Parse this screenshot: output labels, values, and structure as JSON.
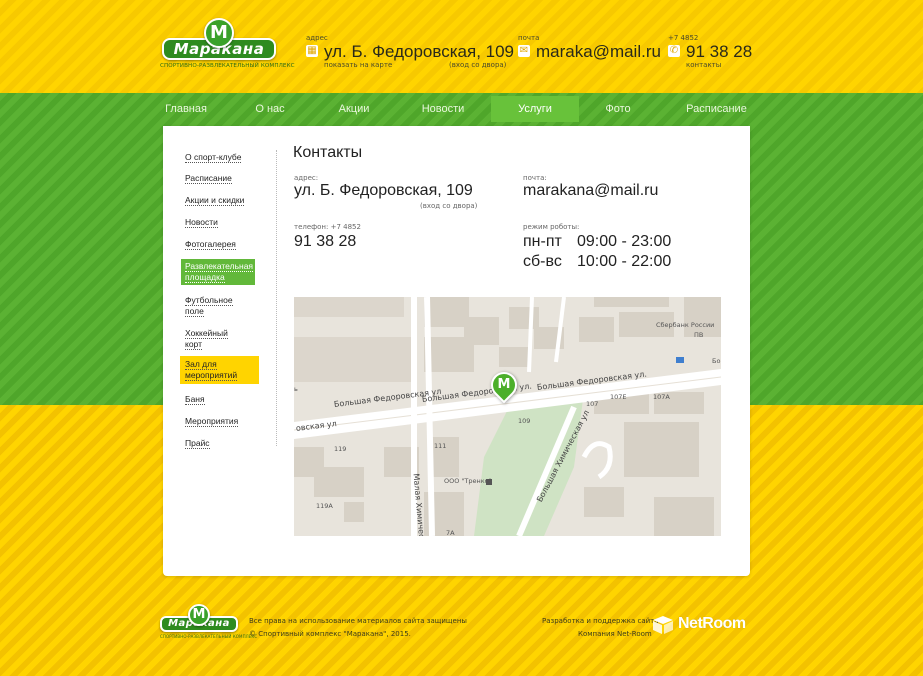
{
  "brand": {
    "logo_text": "Маракана",
    "logo_letter": "M",
    "tagline": "спортивно-развлекательный комплекс"
  },
  "header": {
    "address_label": "адрес",
    "address_value": "ул. Б. Федоровская, 109",
    "address_show_map": "показать на карте",
    "address_entrance": "(вход со двора)",
    "email_label": "почта",
    "email_value": "maraka@mail.ru",
    "phone_label": "+7 4852",
    "phone_value": "91 38 28",
    "phone_sub": "контакты"
  },
  "nav": {
    "items": [
      "Главная",
      "О нас",
      "Акции",
      "Новости",
      "Услуги",
      "Фото",
      "Расписание"
    ],
    "active_index": 4
  },
  "sidebar": {
    "items": [
      "О спорт-клубе",
      "Расписание",
      "Акции и скидки",
      "Новости",
      "Фотогалерея",
      "Развлекательная площадка",
      "Футбольное поле",
      "Хоккейный корт",
      "Зал для мероприятий",
      "Баня",
      "Мероприятия",
      "Прайс"
    ]
  },
  "contacts": {
    "title": "Контакты",
    "address_label": "адрес:",
    "address_value": "ул. Б. Федоровская, 109",
    "address_sub": "(вход со двора)",
    "email_label": "почта:",
    "email_value": "marakana@mail.ru",
    "phone_label": "телефон: +7 4852",
    "phone_value": "91 38 28",
    "hours_label": "режим роботы:",
    "hours": [
      {
        "days": "пн-пт",
        "time": "09:00 - 23:00"
      },
      {
        "days": "сб-вс",
        "time": "10:00 - 22:00"
      }
    ]
  },
  "map": {
    "pin_letter": "M",
    "streets": {
      "main_left": "овская ул",
      "main_mid": "Большая Федоровская ул",
      "main_right": "Большая Федоровская ул.",
      "main_far": "Большая Федоровская ул.",
      "malaya": "Малая Химическая",
      "bolshaya_chem": "Большая Химическая ул"
    },
    "labels": {
      "sberbank": "Сбербанк России",
      "sberbank_sub": "ПВ",
      "l107": "107",
      "l107e": "107Е",
      "l107a": "107А",
      "l109": "109",
      "l111": "111",
      "l119": "119",
      "l119a": "119А",
      "l7a": "7А",
      "ooo": "ООО \"Тренко\"",
      "bo": "Бо",
      "b": "ь"
    }
  },
  "footer": {
    "rights": "Все права на использование материалов сайта защищены",
    "copyright": "© Спортивный комплекс \"Маракана\", 2015.",
    "dev": "Разработка и поддержка сайта",
    "company": "Компания Net-Room",
    "netroom": "NetRoom"
  }
}
